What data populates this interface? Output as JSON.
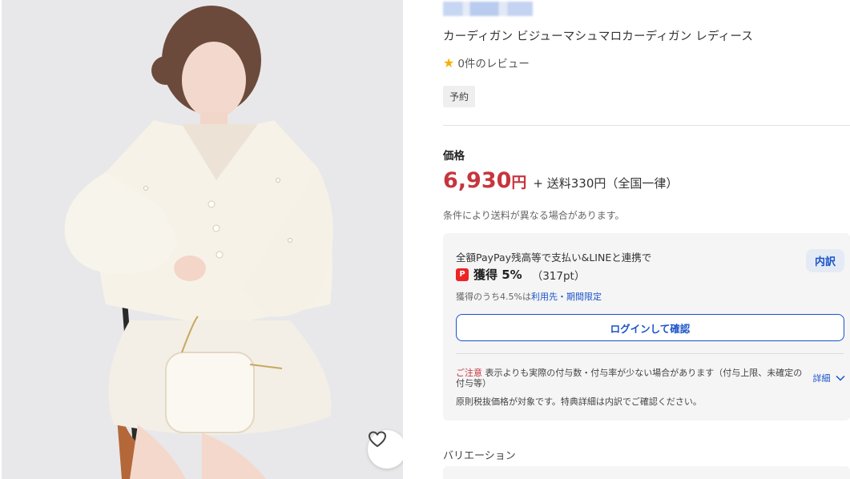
{
  "product": {
    "title": "カーディガン ビジューマシュマロカーディガン レディース",
    "review_label": "0件のレビュー",
    "badge": "予約"
  },
  "price": {
    "label": "価格",
    "amount": "6,930",
    "yen": "円",
    "shipping": "+ 送料330円（全国一律）",
    "note": "条件により送料が異なる場合があります。"
  },
  "points": {
    "heading": "全額PayPay残高等で支払い&LINEと連携で",
    "breakdown_label": "内訳",
    "paypay_icon": "P",
    "rate": "獲得 5%",
    "points": "（317pt）",
    "sub_prefix": "獲得のうち4.5%は",
    "sub_link": "利用先・期間限定",
    "login_label": "ログインして確認",
    "caution_tag": "ご注意",
    "caution_text": "表示よりも実際の付与数・付与率が少ない場合があります（付与上限、未確定の付与等）",
    "detail_label": "詳細",
    "note": "原則税抜価格が対象です。特典詳細は内訳でご確認ください。"
  },
  "variation": {
    "label": "バリエーション"
  },
  "colors": {
    "price_red": "#c7353e",
    "link_blue": "#1a53c8",
    "star": "#f2b200"
  }
}
